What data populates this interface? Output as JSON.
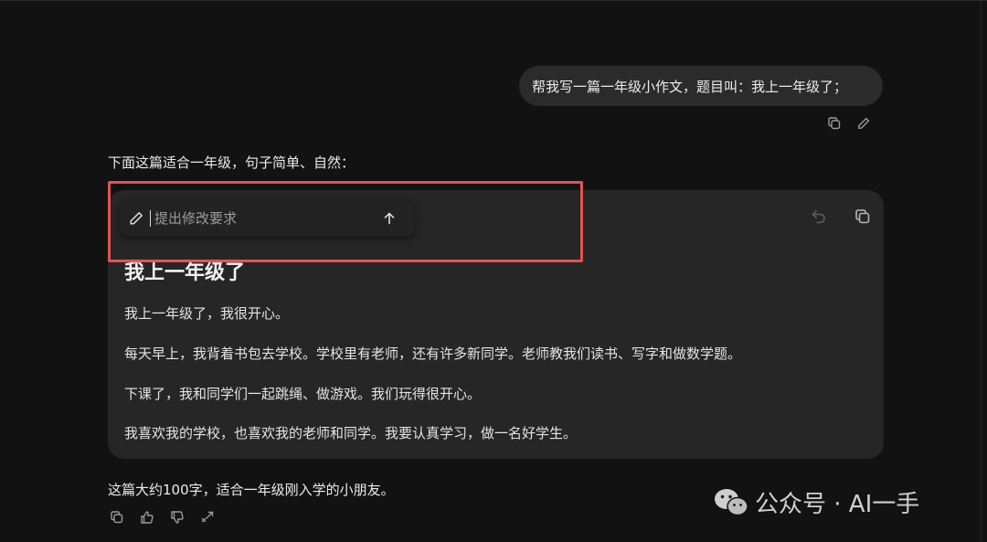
{
  "chat": {
    "user_message": "帮我写一篇一年级小作文，题目叫：我上一年级了；",
    "assistant_intro": "下面这篇适合一年级，句子简单、自然：",
    "assistant_outro": "这篇大约100字，适合一年级刚入学的小朋友。"
  },
  "edit_popup": {
    "placeholder": "提出修改要求"
  },
  "document": {
    "title": "我上一年级了",
    "paragraphs": [
      "我上一年级了，我很开心。",
      "每天早上，我背着书包去学校。学校里有老师，还有许多新同学。老师教我们读书、写字和做数学题。",
      "下课了，我和同学们一起跳绳、做游戏。我们玩得很开心。",
      "我喜欢我的学校，也喜欢我的老师和同学。我要认真学习，做一名好学生。"
    ]
  },
  "watermark": {
    "text": "公众号 · AI一手"
  },
  "colors": {
    "background": "#121212",
    "card": "#262626",
    "user_bubble": "#2b2b2b",
    "highlight": "#e05454"
  },
  "icons": {
    "user_actions": [
      "copy-icon",
      "pencil-icon"
    ],
    "card_tools": [
      "undo-icon",
      "copy-icon"
    ],
    "bottom_actions": [
      "copy-icon",
      "thumbs-up-icon",
      "thumbs-down-icon",
      "share-icon"
    ]
  }
}
